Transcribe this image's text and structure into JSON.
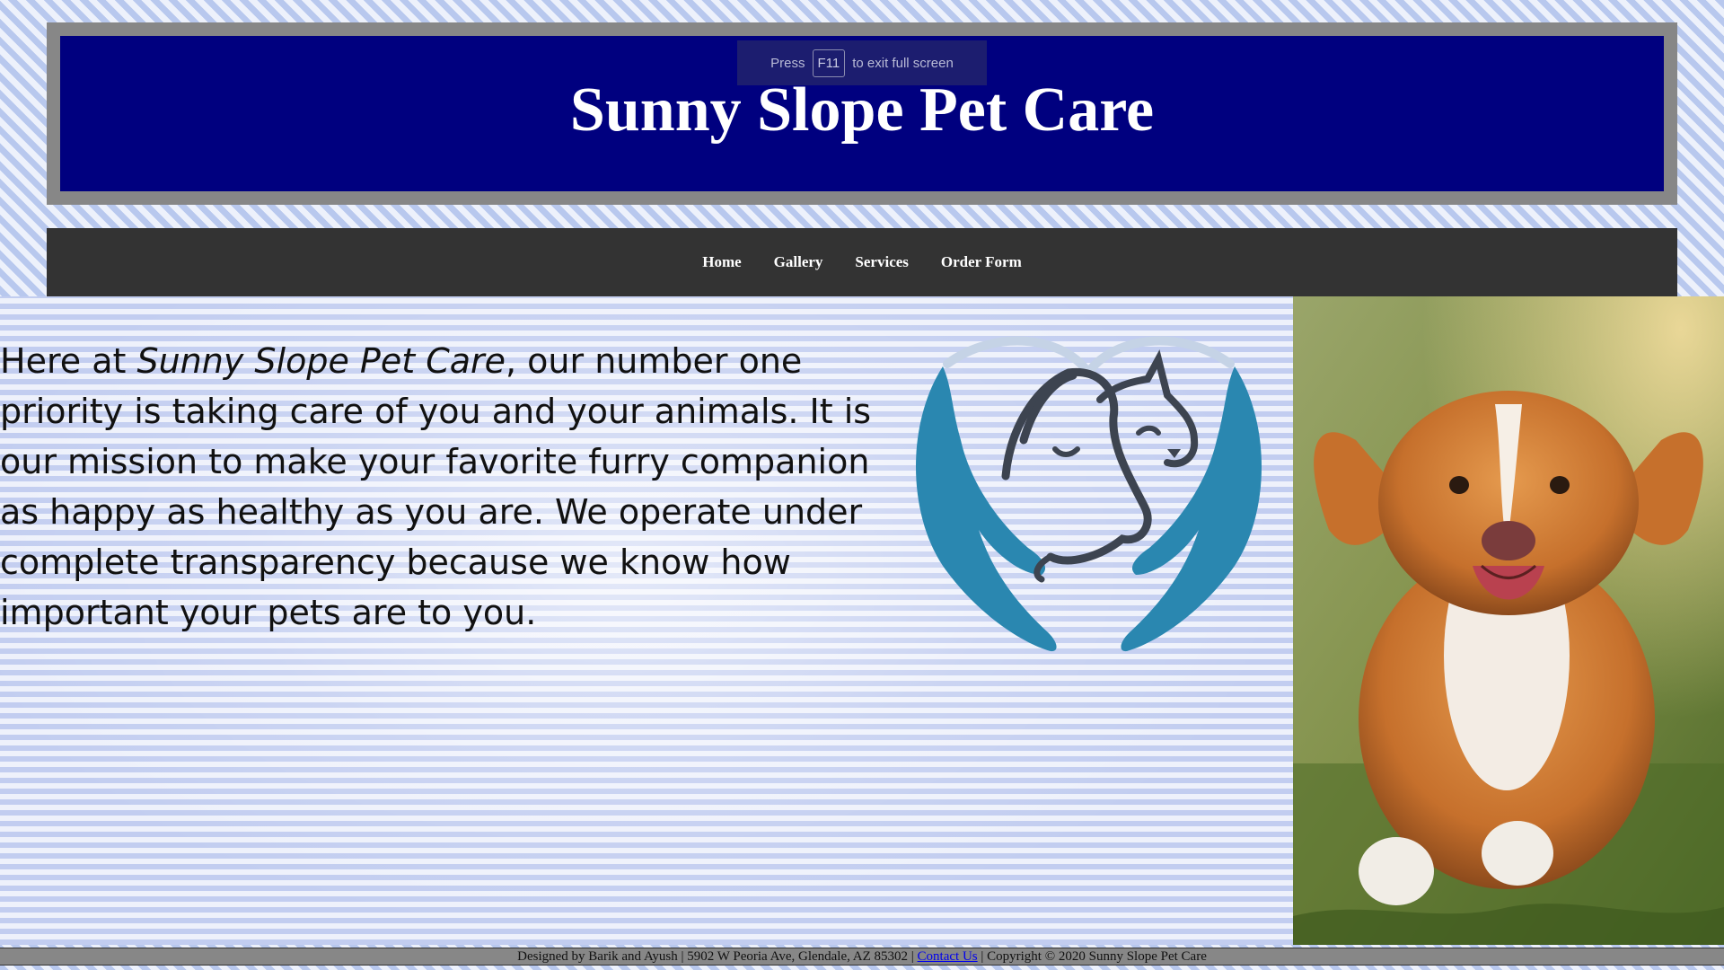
{
  "fullscreen_notice": {
    "press": "Press",
    "key": "F11",
    "rest": "to exit full screen"
  },
  "header": {
    "title": "Sunny Slope Pet Care"
  },
  "nav": {
    "items": [
      {
        "label": "Home"
      },
      {
        "label": "Gallery"
      },
      {
        "label": "Services"
      },
      {
        "label": "Order Form"
      }
    ]
  },
  "main": {
    "intro_before": "Here at ",
    "intro_emphasis": "Sunny Slope Pet Care",
    "intro_after": ", our number one priority is taking care of you and your animals. It is our mission to make your favorite furry companion as happy as healthy as you are. We operate under complete transparency because we know how important your pets are to you."
  },
  "footer": {
    "designed_by": "Designed by Barik and Ayush | 5902 W Peoria Ave, Glendale, AZ 85302 | ",
    "contact_link": "Contact Us",
    "copyright": " | Copyright © 2020 Sunny Slope Pet Care"
  },
  "colors": {
    "header_bg": "#00007f",
    "header_frame": "#878787",
    "nav_bg": "#333333",
    "logo_blue": "#2a87b0",
    "logo_dark": "#3d4450"
  }
}
